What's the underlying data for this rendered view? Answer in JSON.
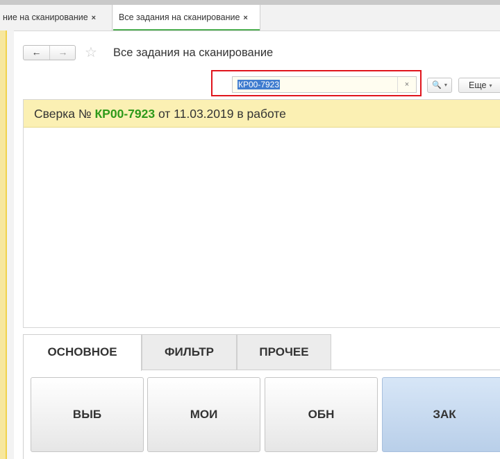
{
  "tabs": [
    {
      "label": "ние на сканирование",
      "close": "×"
    },
    {
      "label": "Все задания на сканирование",
      "close": "×"
    }
  ],
  "nav": {
    "back": "←",
    "forward": "→",
    "star": "☆"
  },
  "page_title": "Все задания на сканирование",
  "search": {
    "value": "КР00-7923",
    "clear": "×"
  },
  "toolbar": {
    "find_icon": "search-icon",
    "find_glyph": "🔍",
    "chevron": "▾",
    "more_label": "Еще"
  },
  "status": {
    "prefix": "Сверка №",
    "number": "КР00-7923",
    "suffix": "от 11.03.2019 в работе"
  },
  "section_tabs": [
    {
      "label": "ОСНОВНОЕ"
    },
    {
      "label": "ФИЛЬТР"
    },
    {
      "label": "ПРОЧЕЕ"
    }
  ],
  "buttons": [
    {
      "label": "ВЫБ"
    },
    {
      "label": "МОИ"
    },
    {
      "label": "ОБН"
    },
    {
      "label": "ЗАК"
    }
  ],
  "colors": {
    "accent_green": "#4caf50",
    "status_bg": "#fbf0b3",
    "highlight_red": "#e0141c",
    "active_button": "#c7daf0"
  }
}
